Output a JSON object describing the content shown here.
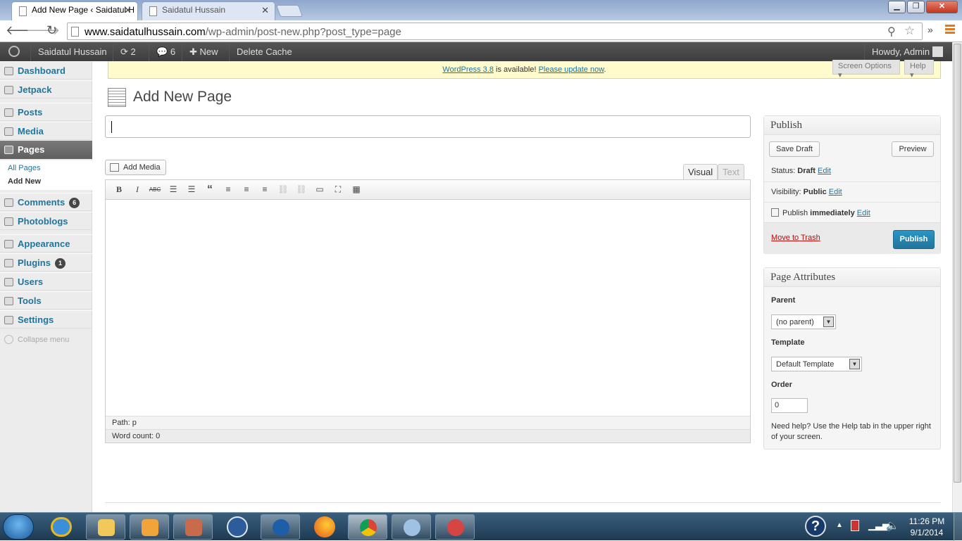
{
  "browser": {
    "tabs": [
      {
        "title": "Add New Page ‹ Saidatul H",
        "active": true
      },
      {
        "title": "Saidatul Hussain",
        "active": false
      }
    ],
    "close_glyph": "✕",
    "url_host": "www.saidatulhussain.com",
    "url_path": "/wp-admin/post-new.php?post_type=page",
    "nav_icons": [
      "back-arrow-icon",
      "forward-arrow-icon",
      "reload-icon"
    ],
    "menu_glyph": "»"
  },
  "admin_bar": {
    "site_name": "Saidatul Hussain",
    "updates_count": "2",
    "comments_count": "6",
    "new_label": "New",
    "delete_cache_label": "Delete Cache",
    "howdy": "Howdy, Admin"
  },
  "sidebar": {
    "items": [
      {
        "label": "Dashboard",
        "icon": "dashboard-icon"
      },
      {
        "label": "Jetpack",
        "icon": "jetpack-icon"
      },
      {
        "label": "Posts",
        "icon": "pin-icon"
      },
      {
        "label": "Media",
        "icon": "media-icon"
      },
      {
        "label": "Pages",
        "icon": "pages-icon",
        "current": true
      },
      {
        "label": "Comments",
        "icon": "comment-icon",
        "badge": "6"
      },
      {
        "label": "Photoblogs",
        "icon": "pin-icon"
      },
      {
        "label": "Appearance",
        "icon": "appearance-icon"
      },
      {
        "label": "Plugins",
        "icon": "plugin-icon",
        "badge": "1"
      },
      {
        "label": "Users",
        "icon": "users-icon"
      },
      {
        "label": "Tools",
        "icon": "tools-icon"
      },
      {
        "label": "Settings",
        "icon": "settings-icon"
      }
    ],
    "submenu": [
      "All Pages",
      "Add New"
    ],
    "collapse_label": "Collapse menu"
  },
  "notice": {
    "version_link": "WordPress 3.8",
    "middle": " is available! ",
    "update_link": "Please update now",
    "end": "."
  },
  "screen_options_label": "Screen Options ▾",
  "help_label": "Help ▾",
  "page_title": "Add New Page",
  "add_media_label": "Add Media",
  "editor": {
    "visual_tab": "Visual",
    "text_tab": "Text",
    "toolbar": [
      "B",
      "I",
      "ABC",
      "☰",
      "☰",
      "“",
      "≡",
      "≡",
      "≡",
      "⛓",
      "⛓",
      "▭",
      "⛶",
      "▦"
    ],
    "path": "Path: p",
    "word_count": "Word count: 0"
  },
  "publish_box": {
    "title": "Publish",
    "save_draft": "Save Draft",
    "preview": "Preview",
    "status_label": "Status: ",
    "status_value": "Draft",
    "visibility_label": "Visibility: ",
    "visibility_value": "Public",
    "publish_label": "Publish ",
    "publish_value": "immediately",
    "edit": "Edit",
    "trash": "Move to Trash",
    "publish_button": "Publish"
  },
  "attributes_box": {
    "title": "Page Attributes",
    "parent_label": "Parent",
    "parent_value": "(no parent)",
    "template_label": "Template",
    "template_value": "Default Template",
    "order_label": "Order",
    "order_value": "0",
    "help_line1": "Need help? Use the Help tab in the upper right",
    "help_line2": "of your screen."
  },
  "taskbar": {
    "time": "11:26 PM",
    "date": "9/1/2014",
    "help_glyph": "?"
  },
  "colors": {
    "link": "#21759b",
    "admin_bar": "#464646",
    "notice": "#fffbcc",
    "trash": "#bc0b0b"
  }
}
